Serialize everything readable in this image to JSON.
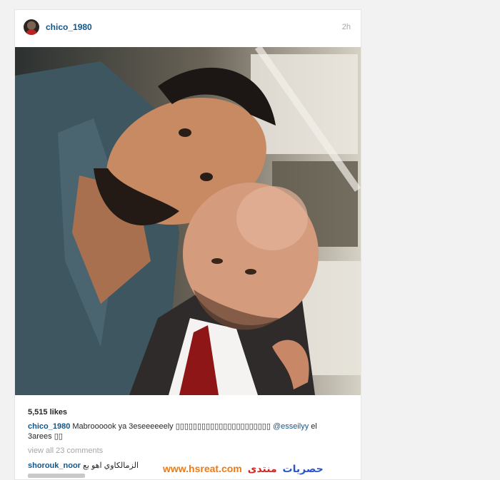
{
  "post": {
    "username": "chico_1980",
    "time": "2h",
    "likes": "5,515 likes",
    "caption": {
      "user": "chico_1980",
      "text_before": "Mabroooook ya 3eseeeeeely ",
      "emoji_boxes": "▯▯▯▯▯▯▯▯▯▯▯▯▯▯▯▯▯▯▯▯▯▯ ",
      "mention": "@esseilyy",
      "text_after": " el 3arees ▯▯"
    },
    "view_all": "view all 23 comments",
    "comments": [
      {
        "user": "shorouk_noor",
        "text": "الزمالكاوي اهو بع"
      }
    ]
  },
  "watermark": {
    "url": "www.hsreat.com",
    "name": "حصريات",
    "word": "منتدى"
  },
  "colors": {
    "link_blue": "#125688",
    "watermark_orange": "#f07a12",
    "watermark_blue": "#2a55c9",
    "watermark_red": "#d42525"
  }
}
